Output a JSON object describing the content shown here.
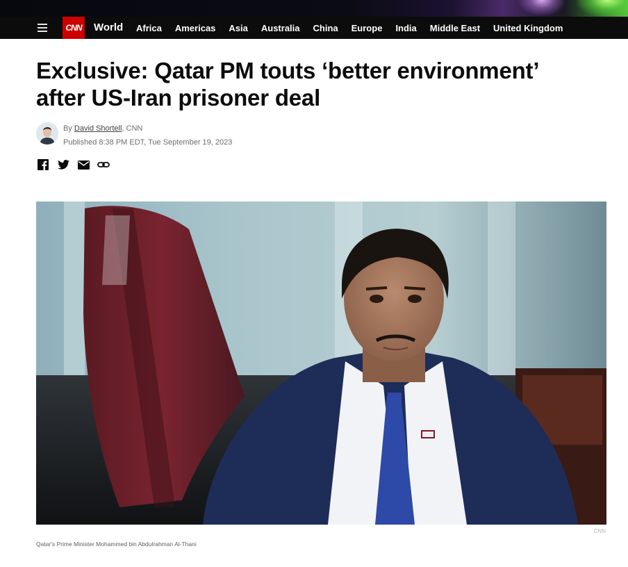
{
  "nav": {
    "section": "World",
    "logo": "CNN",
    "links": [
      "Africa",
      "Americas",
      "Asia",
      "Australia",
      "China",
      "Europe",
      "India",
      "Middle East",
      "United Kingdom"
    ]
  },
  "article": {
    "headline": "Exclusive: Qatar PM touts ‘better environment’ after US-Iran prisoner deal",
    "byline_prefix": "By",
    "author": "David Shortell",
    "outlet": ", CNN",
    "published": "Published 8:38 PM EDT, Tue September 19, 2023",
    "image_credit": "CNN",
    "image_caption": "Qatar's Prime Minister Mohammed bin Abdulrahman Al-Thani"
  },
  "share_icons": [
    "facebook-icon",
    "twitter-icon",
    "email-icon",
    "link-icon"
  ],
  "colors": {
    "brand_red": "#cc0000",
    "nav_bg": "#0c0c0c"
  }
}
